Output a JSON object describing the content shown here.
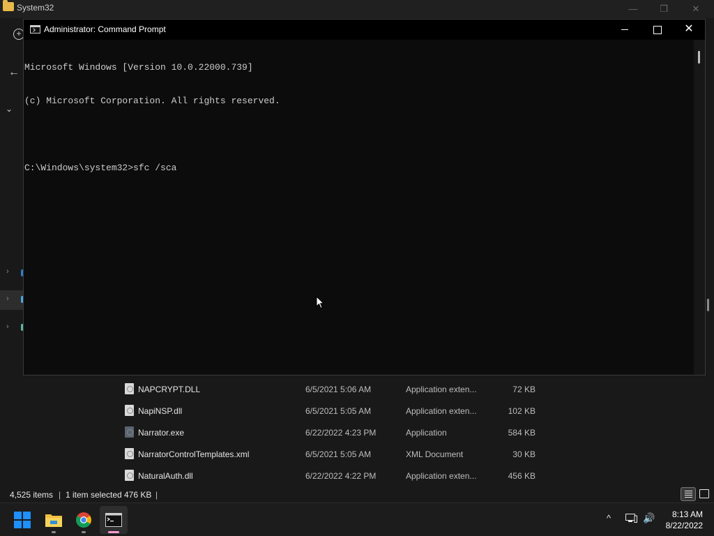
{
  "explorer": {
    "title": "System32",
    "window_controls": {
      "minimize": "—",
      "maximize": "❐",
      "close": "✕"
    },
    "files": [
      {
        "name": "NAPCRYPT.DLL",
        "date": "6/5/2021 5:06 AM",
        "type": "Application exten...",
        "size": "72 KB"
      },
      {
        "name": "NapiNSP.dll",
        "date": "6/5/2021 5:05 AM",
        "type": "Application exten...",
        "size": "102 KB"
      },
      {
        "name": "Narrator.exe",
        "date": "6/22/2022 4:23 PM",
        "type": "Application",
        "size": "584 KB"
      },
      {
        "name": "NarratorControlTemplates.xml",
        "date": "6/5/2021 5:05 AM",
        "type": "XML Document",
        "size": "30 KB"
      },
      {
        "name": "NaturalAuth.dll",
        "date": "6/22/2022 4:22 PM",
        "type": "Application exten...",
        "size": "456 KB"
      }
    ],
    "status": {
      "items_count": "4,525 items",
      "separator": "|",
      "selected": "1 item selected",
      "selected_size": "476 KB"
    }
  },
  "cmd": {
    "title": "Administrator: Command Prompt",
    "close_glyph": "✕",
    "lines": [
      "Microsoft Windows [Version 10.0.22000.739]",
      "(c) Microsoft Corporation. All rights reserved.",
      "",
      "C:\\Windows\\system32>sfc /sca"
    ]
  },
  "taskbar": {
    "apps": [
      "start",
      "file-explorer",
      "chrome",
      "command-prompt"
    ],
    "tray": {
      "chevron": "^",
      "time": "8:13 AM",
      "date": "8/22/2022"
    }
  },
  "icons": {
    "explorer_new": "+",
    "explorer_back": "←",
    "explorer_expand": "⌄",
    "nav_chevron": "›",
    "volume": "🔊"
  },
  "colors": {
    "console_bg": "#0c0c0c",
    "console_text": "#cccccc",
    "cmd_indicator": "#ff9ad1",
    "windows_blue": "#0078d4"
  }
}
